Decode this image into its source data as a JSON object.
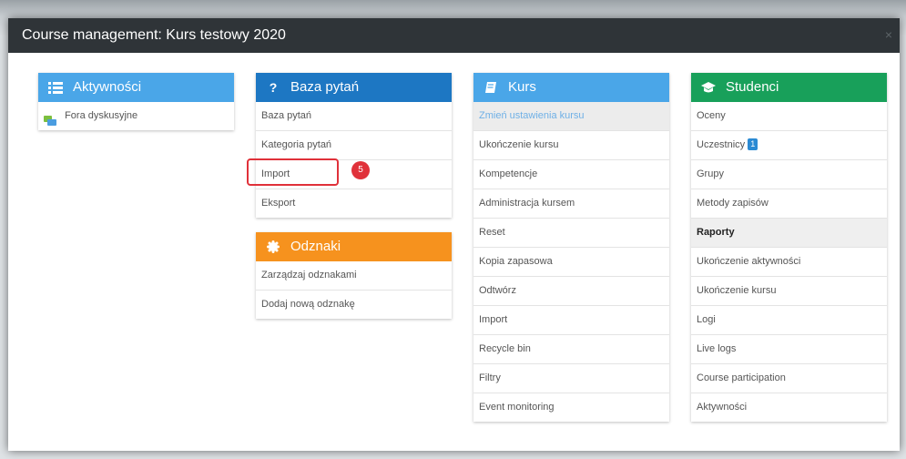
{
  "modal": {
    "title": "Course management: Kurs testowy 2020",
    "close_glyph": "×"
  },
  "colors": {
    "header_dark": "#2f3438",
    "light_blue": "#4aa6e8",
    "dark_blue": "#1d77c3",
    "orange": "#f6921e",
    "green": "#18a05a",
    "callout_red": "#e0313a"
  },
  "blocks": {
    "aktywnosci": {
      "title": "Aktywności",
      "icon": "list-icon",
      "items": [
        "Fora dyskusyjne"
      ]
    },
    "baza_pytan": {
      "title": "Baza pytań",
      "icon": "question-icon",
      "items": [
        "Baza pytań",
        "Kategoria pytań",
        "Import",
        "Eksport"
      ]
    },
    "odznaki": {
      "title": "Odznaki",
      "icon": "badge-icon",
      "items": [
        "Zarządzaj odznakami",
        "Dodaj nową odznakę"
      ]
    },
    "kurs": {
      "title": "Kurs",
      "icon": "book-icon",
      "items": [
        "Zmień ustawienia kursu",
        "Ukończenie kursu",
        "Kompetencje",
        "Administracja kursem",
        "Reset",
        "Kopia zapasowa",
        "Odtwórz",
        "Import",
        "Recycle bin",
        "Filtry",
        "Event monitoring"
      ]
    },
    "studenci": {
      "title": "Studenci",
      "icon": "graduation-cap-icon",
      "items": [
        "Oceny",
        "Uczestnicy",
        "Grupy",
        "Metody zapisów",
        "Raporty",
        "Ukończenie aktywności",
        "Ukończenie kursu",
        "Logi",
        "Live logs",
        "Course participation",
        "Aktywności"
      ],
      "uczestnicy_badge": "1"
    }
  },
  "callout": {
    "step_number": "5"
  }
}
